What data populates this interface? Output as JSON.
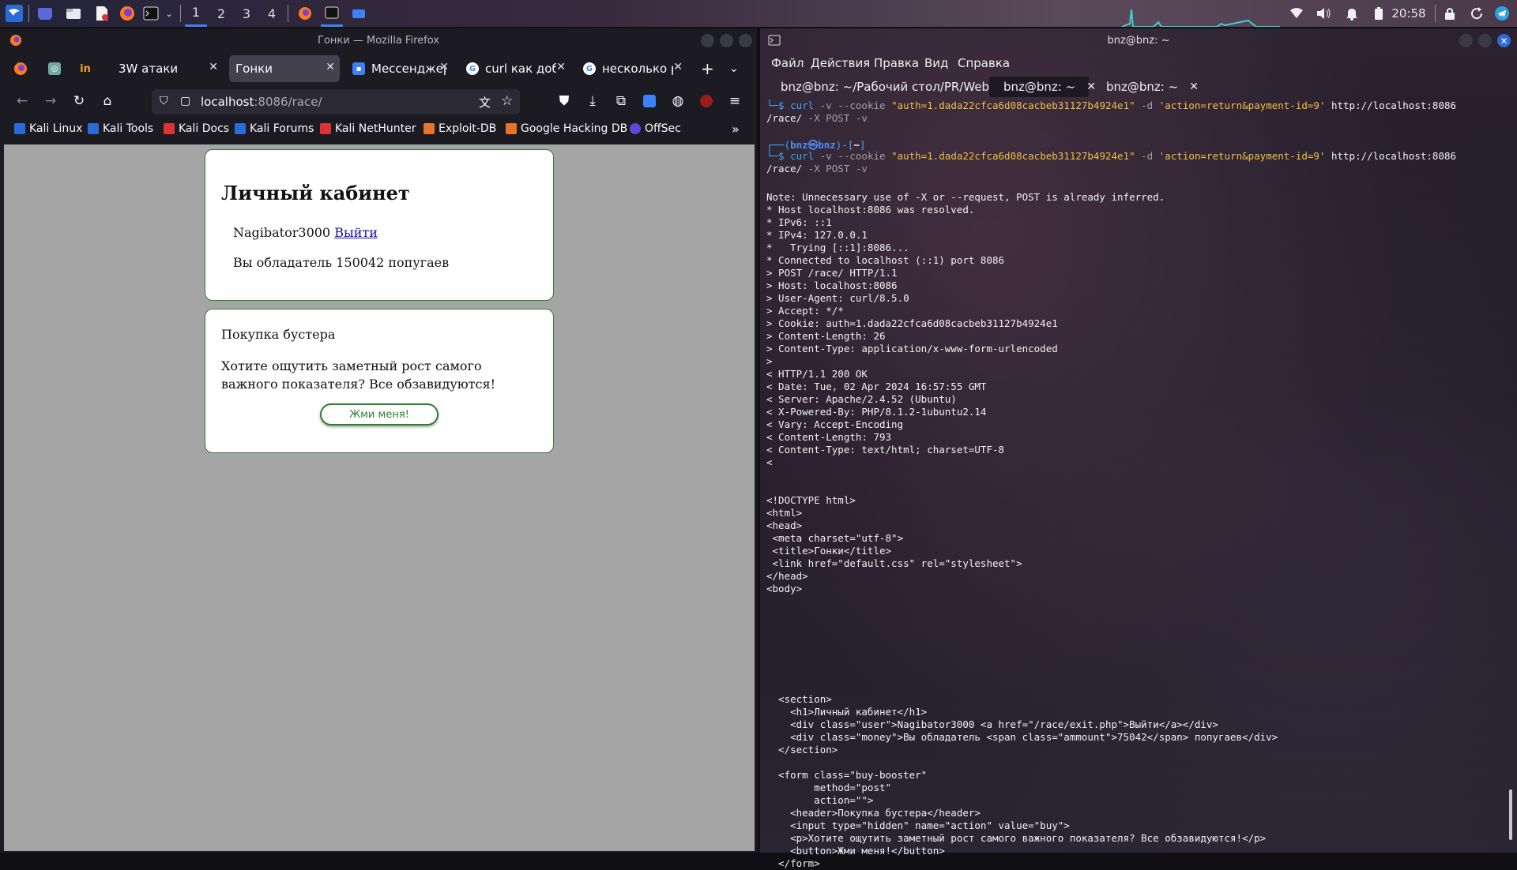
{
  "panel": {
    "workspaces": [
      "1",
      "2",
      "3",
      "4"
    ],
    "clock": "20:58"
  },
  "firefox": {
    "window_title": "Гонки — Mozilla Firefox",
    "tabs": [
      {
        "label": "3W атаки"
      },
      {
        "label": "Гонки"
      },
      {
        "label": "Мессенджер"
      },
      {
        "label": "curl как доба"
      },
      {
        "label": "несколько ра"
      }
    ],
    "url_host": "localhost",
    "url_rest": ":8086/race/",
    "bookmarks": [
      "Kali Linux",
      "Kali Tools",
      "Kali Docs",
      "Kali Forums",
      "Kali NetHunter",
      "Exploit-DB",
      "Google Hacking DB",
      "OffSec"
    ],
    "page": {
      "card1": {
        "title": "Личный кабинет",
        "username": "Nagibator3000",
        "logout_link": "Выйти",
        "money_text": "Вы обладатель 150042 попугаев"
      },
      "card2": {
        "header": "Покупка бустера",
        "text": "Хотите ощутить заметный рост самого важного показателя? Все обзавидуются!",
        "button": "Жми меня!"
      }
    }
  },
  "terminal": {
    "window_title": "bnz@bnz: ~",
    "menu": [
      "Файл",
      "Действия",
      "Правка",
      "Вид",
      "Справка"
    ],
    "tabs": [
      {
        "label": "bnz@bnz: ~/Рабочий стол/PR/Web"
      },
      {
        "label": "bnz@bnz: ~"
      },
      {
        "label": "bnz@bnz: ~"
      }
    ],
    "prompt_user": "bnz",
    "prompt_host": "bnz",
    "prompt_dir": "~",
    "cmd1_curl": "curl",
    "cmd1_opts": " -v --cookie ",
    "cmd1_cookie": "\"auth=1.dada22cfca6d08cacbeb31127b4924e1\"",
    "cmd1_d": " -d ",
    "cmd1_data": "'action=return&payment-id=9'",
    "cmd1_url": " http://localhost:8086",
    "cmd1_line2": "/race/",
    "cmd1_tail": " -X POST -v",
    "output": [
      "Note: Unnecessary use of -X or --request, POST is already inferred.",
      "* Host localhost:8086 was resolved.",
      "* IPv6: ::1",
      "* IPv4: 127.0.0.1",
      "*   Trying [::1]:8086...",
      "* Connected to localhost (::1) port 8086",
      "> POST /race/ HTTP/1.1",
      "> Host: localhost:8086",
      "> User-Agent: curl/8.5.0",
      "> Accept: */*",
      "> Cookie: auth=1.dada22cfca6d08cacbeb31127b4924e1",
      "> Content-Length: 26",
      "> Content-Type: application/x-www-form-urlencoded",
      ">",
      "< HTTP/1.1 200 OK",
      "< Date: Tue, 02 Apr 2024 16:57:55 GMT",
      "< Server: Apache/2.4.52 (Ubuntu)",
      "< X-Powered-By: PHP/8.1.2-1ubuntu2.14",
      "< Vary: Accept-Encoding",
      "< Content-Length: 793",
      "< Content-Type: text/html; charset=UTF-8",
      "<",
      "",
      "",
      "<!DOCTYPE html>",
      "<html>",
      "<head>",
      " <meta charset=\"utf-8\">",
      " <title>Гонки</title>",
      " <link href=\"default.css\" rel=\"stylesheet\">",
      "</head>",
      "<body>"
    ],
    "output2": [
      "  <section>",
      "    <h1>Личный кабинет</h1>",
      "    <div class=\"user\">Nagibator3000 <a href=\"/race/exit.php\">Выйти</a></div>",
      "    <div class=\"money\">Вы обладатель <span class=\"ammount\">75042</span> попугаев</div>",
      "  </section>",
      "",
      "  <form class=\"buy-booster\"",
      "        method=\"post\"",
      "        action=\"\">",
      "    <header>Покупка бустера</header>",
      "    <input type=\"hidden\" name=\"action\" value=\"buy\">",
      "    <p>Хотите ощутить заметный рост самого важного показателя? Все обзавидуются!</p>",
      "    <button>Жми меня!</button>",
      "  </form>"
    ]
  }
}
